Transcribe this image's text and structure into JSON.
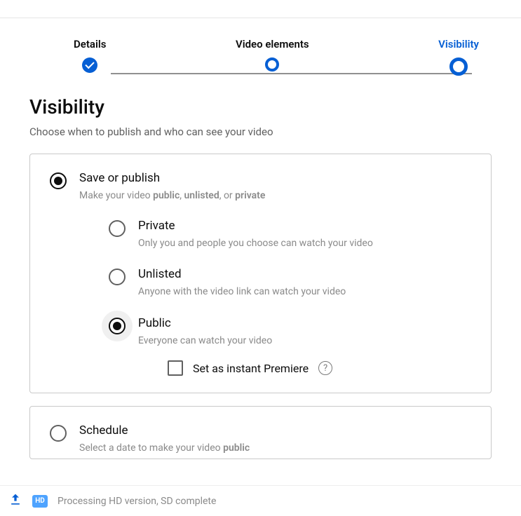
{
  "stepper": {
    "details": "Details",
    "elements": "Video elements",
    "visibility": "Visibility"
  },
  "section": {
    "title": "Visibility",
    "subtitle": "Choose when to publish and who can see your video"
  },
  "savePublish": {
    "title": "Save or publish",
    "desc_pre": "Make your video ",
    "desc_b1": "public",
    "desc_sep1": ", ",
    "desc_b2": "unlisted",
    "desc_sep2": ", or ",
    "desc_b3": "private",
    "private": {
      "title": "Private",
      "desc": "Only you and people you choose can watch your video"
    },
    "unlisted": {
      "title": "Unlisted",
      "desc": "Anyone with the video link can watch your video"
    },
    "public": {
      "title": "Public",
      "desc": "Everyone can watch your video"
    },
    "premiere": "Set as instant Premiere"
  },
  "schedule": {
    "title": "Schedule",
    "desc_pre": "Select a date to make your video ",
    "desc_b": "public"
  },
  "footer": {
    "hd": "HD",
    "status": "Processing HD version, SD complete"
  }
}
